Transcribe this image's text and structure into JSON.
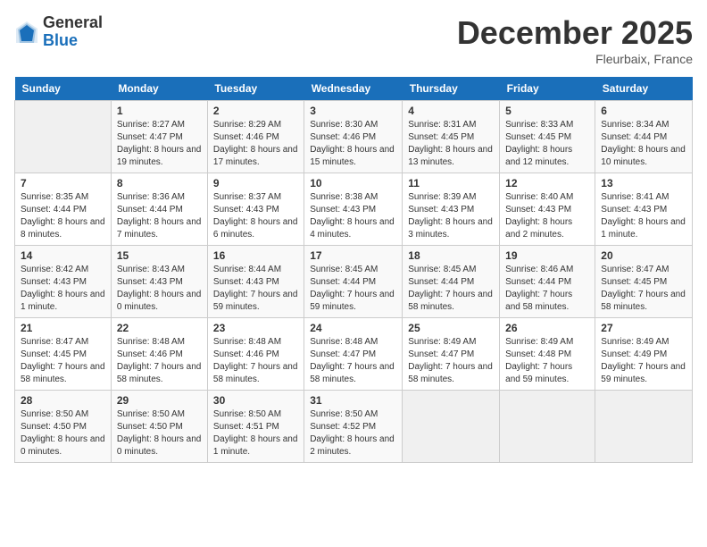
{
  "header": {
    "logo_general": "General",
    "logo_blue": "Blue",
    "month_title": "December 2025",
    "location": "Fleurbaix, France"
  },
  "days_of_week": [
    "Sunday",
    "Monday",
    "Tuesday",
    "Wednesday",
    "Thursday",
    "Friday",
    "Saturday"
  ],
  "weeks": [
    [
      {
        "day": "",
        "sunrise": "",
        "sunset": "",
        "daylight": ""
      },
      {
        "day": "1",
        "sunrise": "Sunrise: 8:27 AM",
        "sunset": "Sunset: 4:47 PM",
        "daylight": "Daylight: 8 hours and 19 minutes."
      },
      {
        "day": "2",
        "sunrise": "Sunrise: 8:29 AM",
        "sunset": "Sunset: 4:46 PM",
        "daylight": "Daylight: 8 hours and 17 minutes."
      },
      {
        "day": "3",
        "sunrise": "Sunrise: 8:30 AM",
        "sunset": "Sunset: 4:46 PM",
        "daylight": "Daylight: 8 hours and 15 minutes."
      },
      {
        "day": "4",
        "sunrise": "Sunrise: 8:31 AM",
        "sunset": "Sunset: 4:45 PM",
        "daylight": "Daylight: 8 hours and 13 minutes."
      },
      {
        "day": "5",
        "sunrise": "Sunrise: 8:33 AM",
        "sunset": "Sunset: 4:45 PM",
        "daylight": "Daylight: 8 hours and 12 minutes."
      },
      {
        "day": "6",
        "sunrise": "Sunrise: 8:34 AM",
        "sunset": "Sunset: 4:44 PM",
        "daylight": "Daylight: 8 hours and 10 minutes."
      }
    ],
    [
      {
        "day": "7",
        "sunrise": "Sunrise: 8:35 AM",
        "sunset": "Sunset: 4:44 PM",
        "daylight": "Daylight: 8 hours and 8 minutes."
      },
      {
        "day": "8",
        "sunrise": "Sunrise: 8:36 AM",
        "sunset": "Sunset: 4:44 PM",
        "daylight": "Daylight: 8 hours and 7 minutes."
      },
      {
        "day": "9",
        "sunrise": "Sunrise: 8:37 AM",
        "sunset": "Sunset: 4:43 PM",
        "daylight": "Daylight: 8 hours and 6 minutes."
      },
      {
        "day": "10",
        "sunrise": "Sunrise: 8:38 AM",
        "sunset": "Sunset: 4:43 PM",
        "daylight": "Daylight: 8 hours and 4 minutes."
      },
      {
        "day": "11",
        "sunrise": "Sunrise: 8:39 AM",
        "sunset": "Sunset: 4:43 PM",
        "daylight": "Daylight: 8 hours and 3 minutes."
      },
      {
        "day": "12",
        "sunrise": "Sunrise: 8:40 AM",
        "sunset": "Sunset: 4:43 PM",
        "daylight": "Daylight: 8 hours and 2 minutes."
      },
      {
        "day": "13",
        "sunrise": "Sunrise: 8:41 AM",
        "sunset": "Sunset: 4:43 PM",
        "daylight": "Daylight: 8 hours and 1 minute."
      }
    ],
    [
      {
        "day": "14",
        "sunrise": "Sunrise: 8:42 AM",
        "sunset": "Sunset: 4:43 PM",
        "daylight": "Daylight: 8 hours and 1 minute."
      },
      {
        "day": "15",
        "sunrise": "Sunrise: 8:43 AM",
        "sunset": "Sunset: 4:43 PM",
        "daylight": "Daylight: 8 hours and 0 minutes."
      },
      {
        "day": "16",
        "sunrise": "Sunrise: 8:44 AM",
        "sunset": "Sunset: 4:43 PM",
        "daylight": "Daylight: 7 hours and 59 minutes."
      },
      {
        "day": "17",
        "sunrise": "Sunrise: 8:45 AM",
        "sunset": "Sunset: 4:44 PM",
        "daylight": "Daylight: 7 hours and 59 minutes."
      },
      {
        "day": "18",
        "sunrise": "Sunrise: 8:45 AM",
        "sunset": "Sunset: 4:44 PM",
        "daylight": "Daylight: 7 hours and 58 minutes."
      },
      {
        "day": "19",
        "sunrise": "Sunrise: 8:46 AM",
        "sunset": "Sunset: 4:44 PM",
        "daylight": "Daylight: 7 hours and 58 minutes."
      },
      {
        "day": "20",
        "sunrise": "Sunrise: 8:47 AM",
        "sunset": "Sunset: 4:45 PM",
        "daylight": "Daylight: 7 hours and 58 minutes."
      }
    ],
    [
      {
        "day": "21",
        "sunrise": "Sunrise: 8:47 AM",
        "sunset": "Sunset: 4:45 PM",
        "daylight": "Daylight: 7 hours and 58 minutes."
      },
      {
        "day": "22",
        "sunrise": "Sunrise: 8:48 AM",
        "sunset": "Sunset: 4:46 PM",
        "daylight": "Daylight: 7 hours and 58 minutes."
      },
      {
        "day": "23",
        "sunrise": "Sunrise: 8:48 AM",
        "sunset": "Sunset: 4:46 PM",
        "daylight": "Daylight: 7 hours and 58 minutes."
      },
      {
        "day": "24",
        "sunrise": "Sunrise: 8:48 AM",
        "sunset": "Sunset: 4:47 PM",
        "daylight": "Daylight: 7 hours and 58 minutes."
      },
      {
        "day": "25",
        "sunrise": "Sunrise: 8:49 AM",
        "sunset": "Sunset: 4:47 PM",
        "daylight": "Daylight: 7 hours and 58 minutes."
      },
      {
        "day": "26",
        "sunrise": "Sunrise: 8:49 AM",
        "sunset": "Sunset: 4:48 PM",
        "daylight": "Daylight: 7 hours and 59 minutes."
      },
      {
        "day": "27",
        "sunrise": "Sunrise: 8:49 AM",
        "sunset": "Sunset: 4:49 PM",
        "daylight": "Daylight: 7 hours and 59 minutes."
      }
    ],
    [
      {
        "day": "28",
        "sunrise": "Sunrise: 8:50 AM",
        "sunset": "Sunset: 4:50 PM",
        "daylight": "Daylight: 8 hours and 0 minutes."
      },
      {
        "day": "29",
        "sunrise": "Sunrise: 8:50 AM",
        "sunset": "Sunset: 4:50 PM",
        "daylight": "Daylight: 8 hours and 0 minutes."
      },
      {
        "day": "30",
        "sunrise": "Sunrise: 8:50 AM",
        "sunset": "Sunset: 4:51 PM",
        "daylight": "Daylight: 8 hours and 1 minute."
      },
      {
        "day": "31",
        "sunrise": "Sunrise: 8:50 AM",
        "sunset": "Sunset: 4:52 PM",
        "daylight": "Daylight: 8 hours and 2 minutes."
      },
      {
        "day": "",
        "sunrise": "",
        "sunset": "",
        "daylight": ""
      },
      {
        "day": "",
        "sunrise": "",
        "sunset": "",
        "daylight": ""
      },
      {
        "day": "",
        "sunrise": "",
        "sunset": "",
        "daylight": ""
      }
    ]
  ]
}
